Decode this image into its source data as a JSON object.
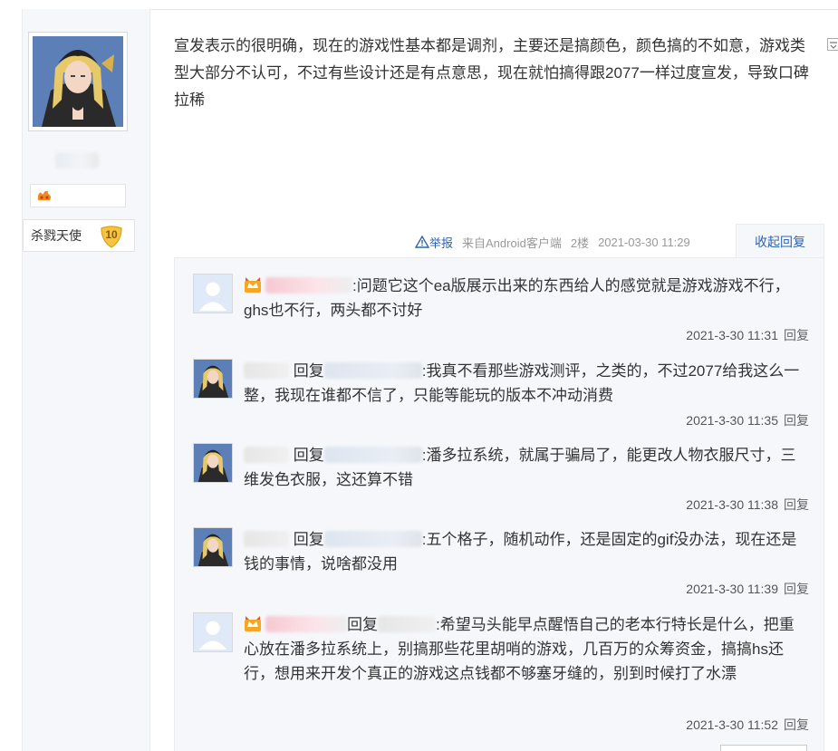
{
  "author": {
    "avatar_icon": "anime-avatar-icon",
    "fan_badge_icon": "flame-badge-icon",
    "level_title": "杀戮天使",
    "level_number": "10"
  },
  "post": {
    "text": "宣发表示的很明确，现在的游戏性基本都是调剂，主要还是搞颜色，颜色搞的不如意，游戏类型大部分不认可，不过有些设计还是有点意思，现在就怕搞得跟2077一样过度宣发，导致口碑拉稀",
    "report_label": "举报",
    "source": "来自Android客户端",
    "floor": "2楼",
    "timestamp": "2021-03-30 11:29",
    "collapse_label": "收起回复"
  },
  "replies": [
    {
      "avatar": "default-avatar-icon",
      "text": ":问题它这个ea版展示出来的东西给人的感觉就是游戏游戏不行，ghs也不行，两头都不讨好",
      "time": "2021-3-30 11:31",
      "reply_label": "回复"
    },
    {
      "avatar": "anime-avatar-icon",
      "reply_word": "回复",
      "text": ":我真不看那些游戏测评，之类的，不过2077给我这么一整，我现在谁都不信了，只能等能玩的版本不冲动消费",
      "time": "2021-3-30 11:35",
      "reply_label": "回复"
    },
    {
      "avatar": "anime-avatar-icon",
      "reply_word": "回复",
      "text": ":潘多拉系统，就属于骗局了，能更改人物衣服尺寸，三维发色衣服，这还算不错",
      "time": "2021-3-30 11:38",
      "reply_label": "回复"
    },
    {
      "avatar": "anime-avatar-icon",
      "reply_word": "回复",
      "text": ":五个格子，随机动作，还是固定的gif没办法，现在还是钱的事情，说啥都没用",
      "time": "2021-3-30 11:39",
      "reply_label": "回复"
    },
    {
      "avatar": "default-avatar-icon",
      "reply_word": "回复",
      "text": ":希望马头能早点醒悟自己的老本行特长是什么，把重心放在潘多拉系统上，别搞那些花里胡哨的游戏，几百万的众筹资金，搞搞hs还行，想用来开发个真正的游戏这点钱都不够塞牙缝的，别到时候打了水漂",
      "time": "2021-3-30 11:52",
      "reply_label": "回复"
    }
  ],
  "colors": {
    "link": "#2d64b3",
    "panel_bg": "#f5f7fa",
    "badge_gold": "#f5c542"
  }
}
